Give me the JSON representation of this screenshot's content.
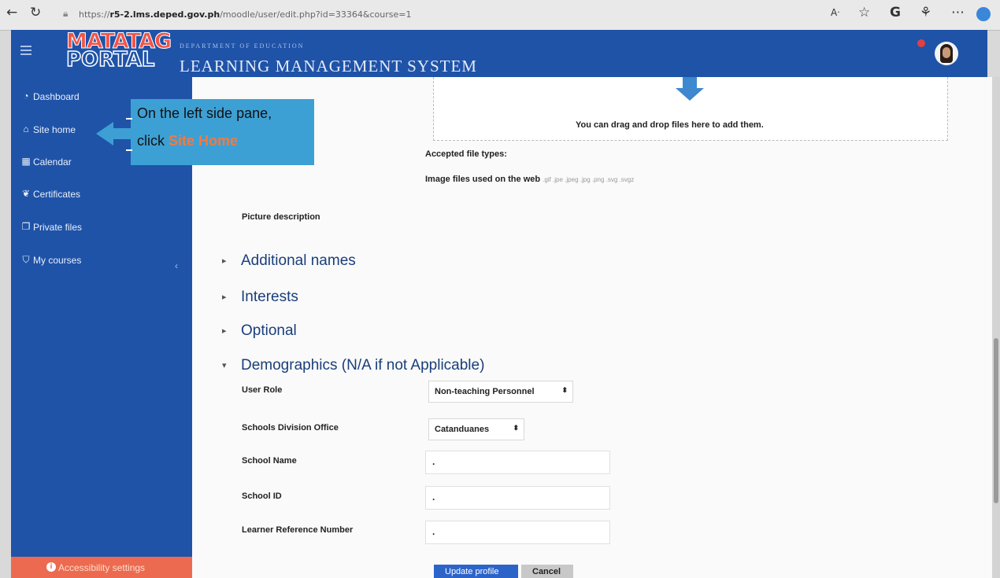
{
  "browser": {
    "back_icon": "back-arrow-icon",
    "refresh_icon": "refresh-icon",
    "url_prefix": "https://",
    "url_host": "r5-2.lms.deped.gov.ph",
    "url_path": "/moodle/user/edit.php?id=33364&course=1",
    "icons": [
      "read-aloud-icon",
      "favorite-star-icon",
      "profile-icon",
      "extensions-icon",
      "more-icon",
      "copilot-icon"
    ]
  },
  "header": {
    "logo_line1": "MATATAG",
    "logo_line2": "PORTAL",
    "dept": "DEPARTMENT OF EDUCATION",
    "title": "LEARNING MANAGEMENT SYSTEM",
    "accent": "#1f53a8"
  },
  "sidebar": {
    "items": [
      {
        "label": "Dashboard",
        "icon": "dashboard-icon"
      },
      {
        "label": "Site home",
        "icon": "home-icon"
      },
      {
        "label": "Calendar",
        "icon": "calendar-icon"
      },
      {
        "label": "Certificates",
        "icon": "certificate-icon"
      },
      {
        "label": "Private files",
        "icon": "file-icon"
      },
      {
        "label": "My courses",
        "icon": "graduation-cap-icon"
      }
    ],
    "accessibility": "Accessibility settings"
  },
  "callout": {
    "line1": "On the left side pane,",
    "line2_prefix": "click ",
    "line2_highlight": "Site Home"
  },
  "main": {
    "drop_text": "You can drag and drop files here to add them.",
    "accepted_label": "Accepted file types:",
    "image_files_label": "Image files used on the web",
    "image_extensions": ".gif .jpe .jpeg .jpg .png .svg .svgz",
    "picture_description": "Picture description",
    "sections": [
      {
        "title": "Additional names",
        "expanded": false
      },
      {
        "title": "Interests",
        "expanded": false
      },
      {
        "title": "Optional",
        "expanded": false
      },
      {
        "title": "Demographics (N/A if not Applicable)",
        "expanded": true
      }
    ],
    "fields": {
      "user_role": {
        "label": "User Role",
        "value": "Non-teaching Personnel"
      },
      "sdo": {
        "label": "Schools Division Office",
        "value": "Catanduanes"
      },
      "school_name": {
        "label": "School Name",
        "value": "."
      },
      "school_id": {
        "label": "School ID",
        "value": "."
      },
      "lrn": {
        "label": "Learner Reference Number",
        "value": "."
      }
    },
    "update_button": "Update profile",
    "cancel_button": "Cancel"
  }
}
